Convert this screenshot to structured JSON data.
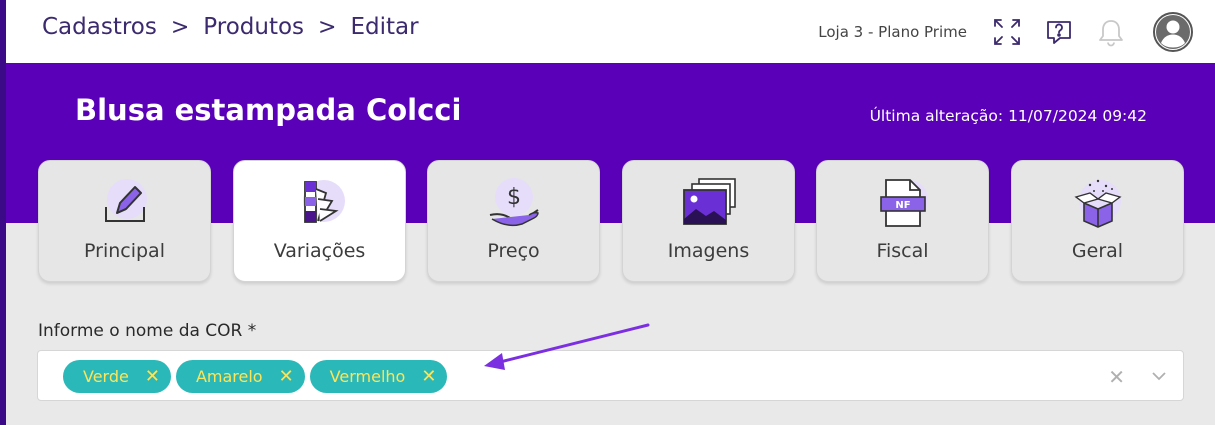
{
  "breadcrumb": {
    "items": [
      "Cadastros",
      "Produtos",
      "Editar"
    ],
    "separator": ">"
  },
  "header": {
    "store": "Loja 3 - Plano Prime",
    "icons": [
      "fullscreen-icon",
      "help-icon",
      "bell-icon",
      "user-avatar-icon"
    ]
  },
  "product": {
    "title": "Blusa estampada Colcci",
    "last_change": "Última alteração: 11/07/2024 09:42"
  },
  "tabs": [
    {
      "label": "Principal",
      "icon": "edit-pencil-icon"
    },
    {
      "label": "Variações",
      "icon": "color-swatch-icon",
      "active": true
    },
    {
      "label": "Preço",
      "icon": "price-hand-icon"
    },
    {
      "label": "Imagens",
      "icon": "images-icon"
    },
    {
      "label": "Fiscal",
      "icon": "nf-document-icon"
    },
    {
      "label": "Geral",
      "icon": "open-box-icon"
    }
  ],
  "color_field": {
    "label": "Informe o nome da COR *",
    "chips": [
      "Verde",
      "Amarelo",
      "Vermelho"
    ]
  },
  "colors": {
    "primary": "#5a00b9",
    "chip_bg": "#2bb8b8",
    "chip_text": "#fbe55a",
    "arrow": "#7b2fe0"
  }
}
